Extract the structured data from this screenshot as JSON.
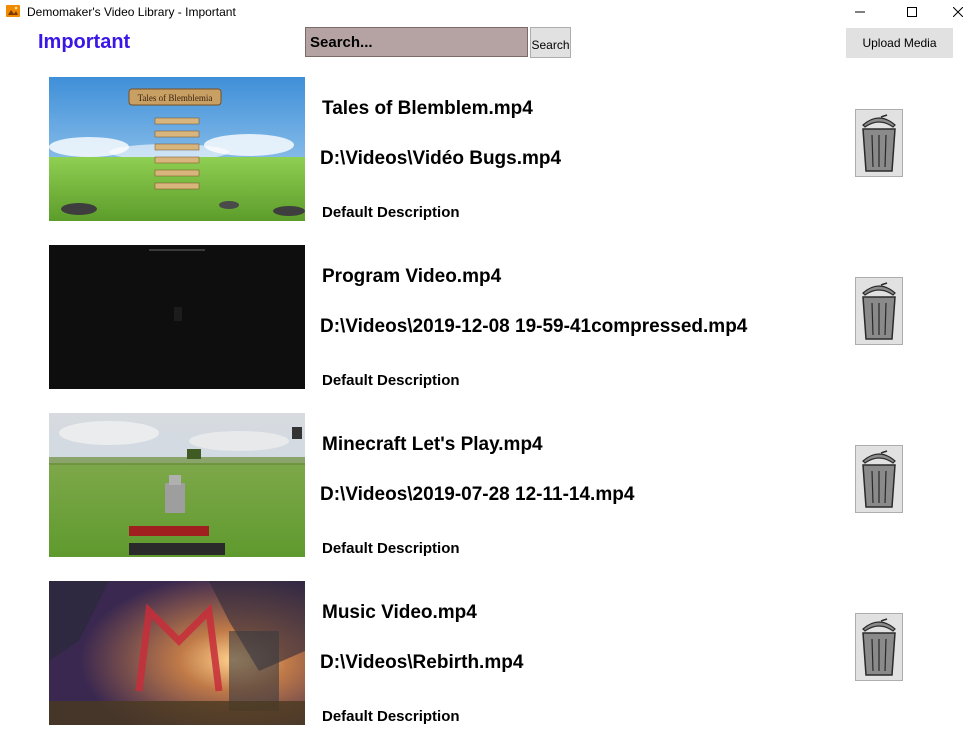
{
  "window": {
    "title": "Demomaker's Video Library - Important",
    "icon": "photo-app-icon"
  },
  "header": {
    "page_title": "Important",
    "search_placeholder": "Search...",
    "search_button_label": "Search",
    "upload_button_label": "Upload Media"
  },
  "videos": [
    {
      "name": "Tales of Blemblem.mp4",
      "path": "D:\\Videos\\Vidéo Bugs.mp4",
      "description": "Default Description",
      "thumb_title": "Tales of Blemblemia",
      "thumbnail": "game-title-screen"
    },
    {
      "name": "Program Video.mp4",
      "path": "D:\\Videos\\2019-12-08 19-59-41compressed.mp4",
      "description": "Default Description",
      "thumbnail": "dark-program-screen"
    },
    {
      "name": "Minecraft Let's Play.mp4",
      "path": "D:\\Videos\\2019-07-28 12-11-14.mp4",
      "description": "Default Description",
      "thumbnail": "minecraft-field"
    },
    {
      "name": "Music Video.mp4",
      "path": "D:\\Videos\\Rebirth.mp4",
      "description": "Default Description",
      "thumbnail": "sunset-logo-scene"
    }
  ],
  "colors": {
    "accent_title": "#3a17e6",
    "search_bg": "#b5a3a3",
    "button_bg": "#e1e1e1"
  }
}
